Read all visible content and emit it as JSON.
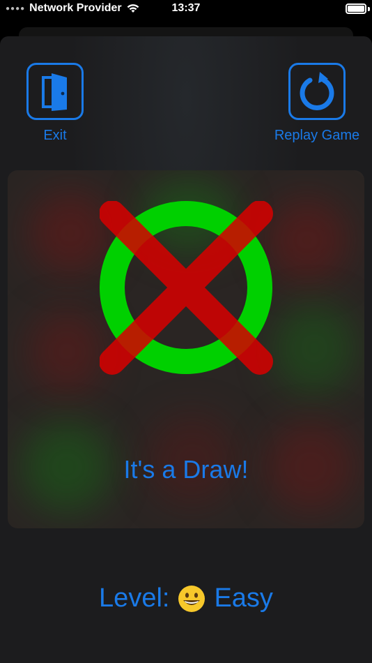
{
  "status_bar": {
    "carrier": "Network Provider",
    "time": "13:37"
  },
  "toolbar": {
    "exit_label": "Exit",
    "replay_label": "Replay Game",
    "exit_icon": "door-icon",
    "replay_icon": "replay-icon"
  },
  "board": {
    "result_text": "It's a Draw!",
    "o_color": "#00d000",
    "x_color": "#d80000"
  },
  "level": {
    "prefix": "Level:",
    "difficulty": "Easy",
    "emoji_icon": "grinning-face-icon"
  },
  "colors": {
    "accent": "#1a7ae8",
    "background": "#1c1c1e"
  }
}
